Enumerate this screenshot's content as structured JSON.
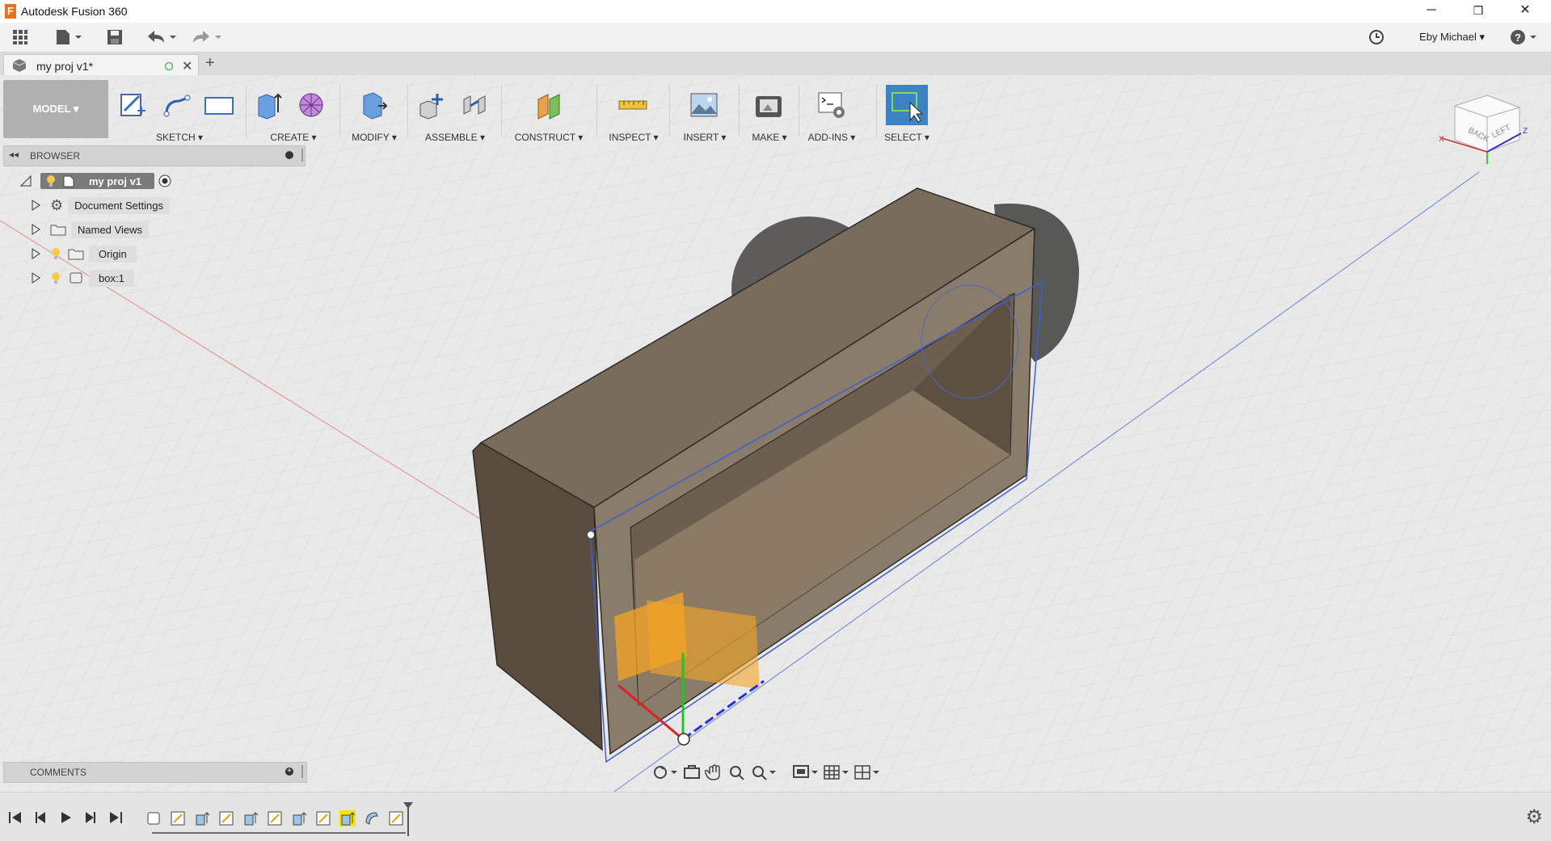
{
  "window": {
    "title": "Autodesk Fusion 360",
    "minimize": "─",
    "restore": "❐",
    "close": "✕"
  },
  "quick_access": {
    "user_label": "Eby Michael ▾",
    "help_label": "?"
  },
  "doc_tab": {
    "label": "my proj v1*",
    "new_tab": "+"
  },
  "ribbon": {
    "workspace": "MODEL ▾",
    "groups": [
      {
        "id": "sketch",
        "label": "SKETCH ▾"
      },
      {
        "id": "create",
        "label": "CREATE ▾"
      },
      {
        "id": "modify",
        "label": "MODIFY ▾"
      },
      {
        "id": "assemble",
        "label": "ASSEMBLE ▾"
      },
      {
        "id": "construct",
        "label": "CONSTRUCT ▾"
      },
      {
        "id": "inspect",
        "label": "INSPECT ▾"
      },
      {
        "id": "insert",
        "label": "INSERT ▾"
      },
      {
        "id": "make",
        "label": "MAKE ▾"
      },
      {
        "id": "addins",
        "label": "ADD-INS ▾"
      },
      {
        "id": "select",
        "label": "SELECT ▾"
      }
    ]
  },
  "browser": {
    "title": "BROWSER",
    "root": "my proj v1",
    "items": [
      {
        "label": "Document Settings"
      },
      {
        "label": "Named Views"
      },
      {
        "label": "Origin"
      },
      {
        "label": "box:1"
      }
    ]
  },
  "comments": {
    "title": "COMMENTS"
  },
  "viewcube": {
    "back": "BACK",
    "left": "LEFT",
    "x": "X",
    "z": "Z"
  },
  "colors": {
    "accent_select": "#3d82c4",
    "model_body": "#6f6253",
    "timeline_highlight": "#f2e500"
  }
}
